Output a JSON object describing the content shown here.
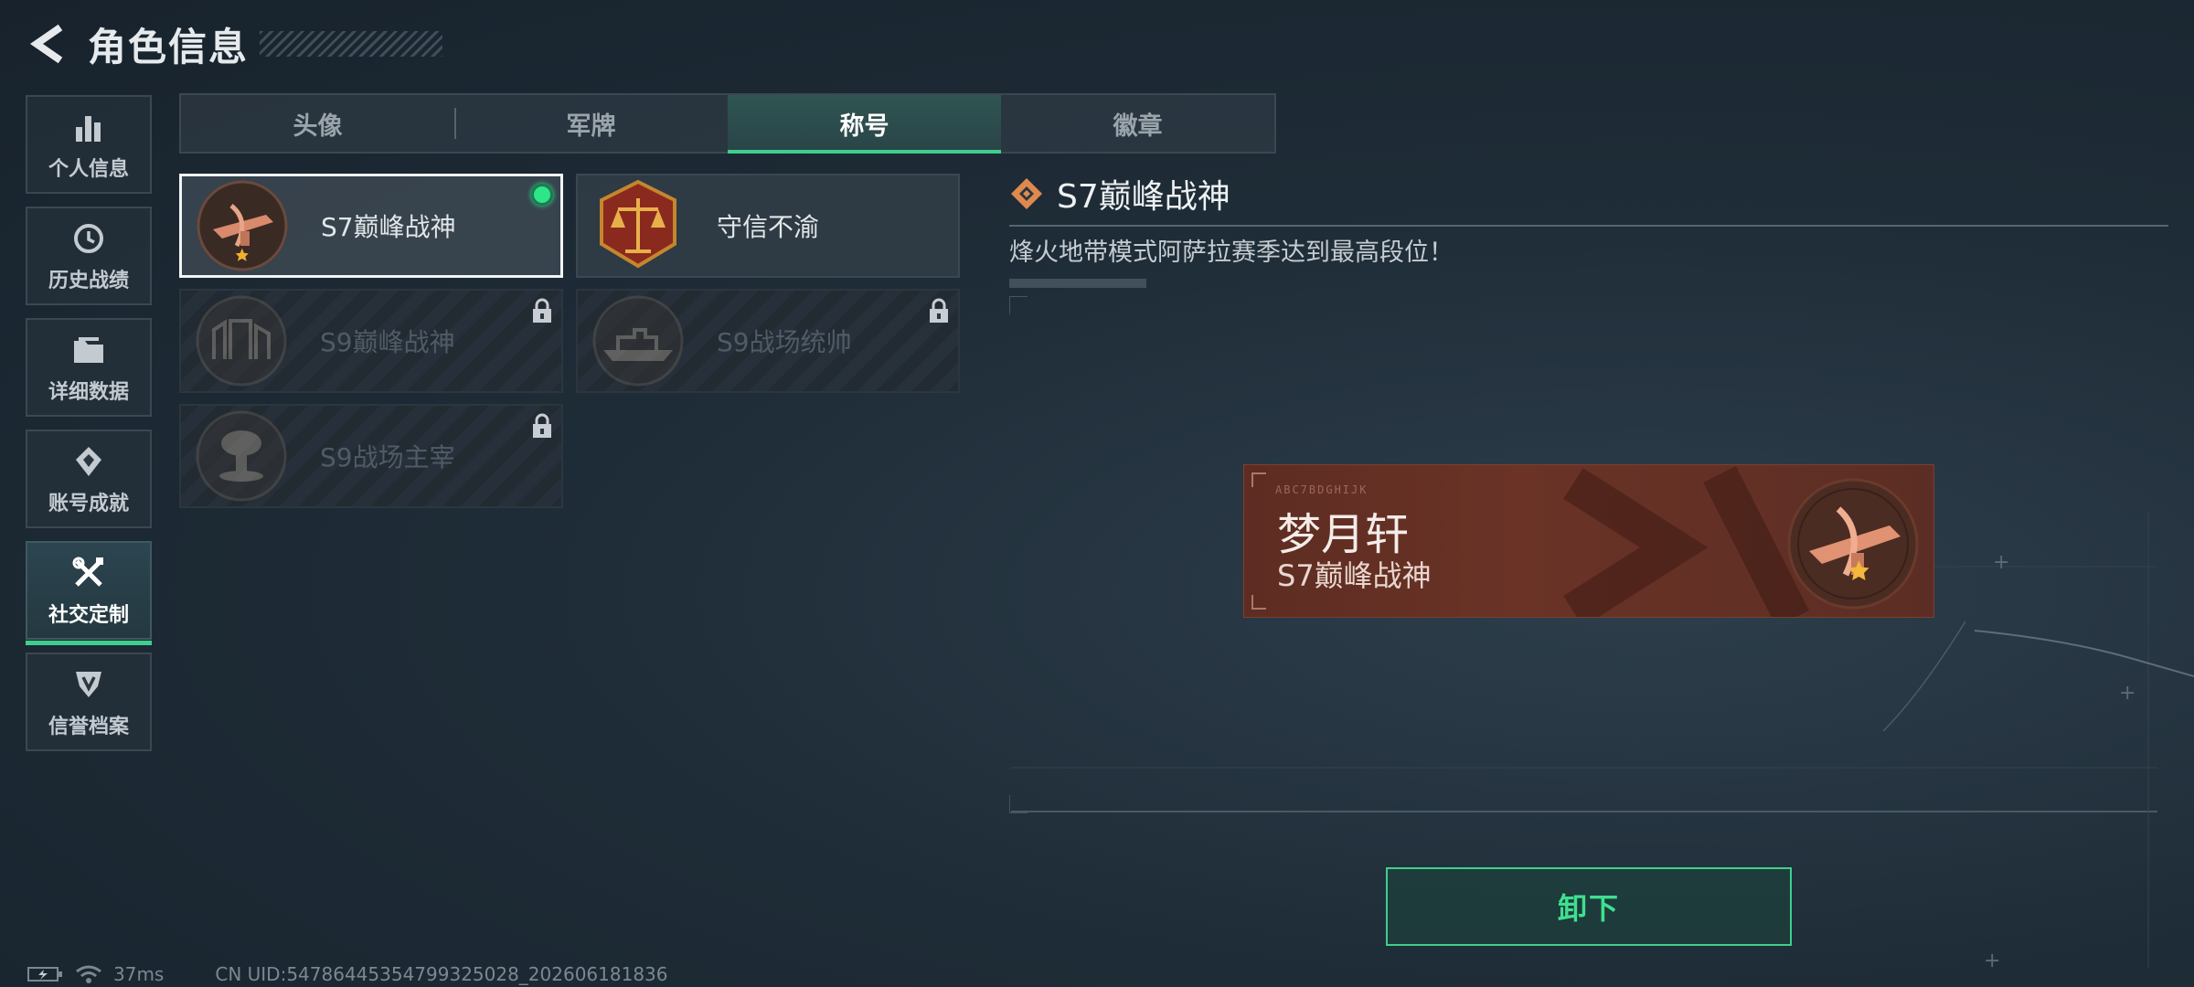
{
  "header": {
    "title": "角色信息"
  },
  "sidenav": {
    "items": [
      {
        "label": "个人信息",
        "icon": "bar-chart-icon",
        "active": false
      },
      {
        "label": "历史战绩",
        "icon": "clock-icon",
        "active": false
      },
      {
        "label": "详细数据",
        "icon": "folder-icon",
        "active": false
      },
      {
        "label": "账号成就",
        "icon": "achievement-icon",
        "active": false
      },
      {
        "label": "社交定制",
        "icon": "tools-icon",
        "active": true
      },
      {
        "label": "信誉档案",
        "icon": "shield-icon",
        "active": false
      }
    ]
  },
  "tabs": [
    {
      "label": "头像",
      "active": false
    },
    {
      "label": "军牌",
      "active": false
    },
    {
      "label": "称号",
      "active": true
    },
    {
      "label": "徽章",
      "active": false
    }
  ],
  "titles": [
    {
      "name": "S7巅峰战神",
      "state": "equipped",
      "emblem": "crossbow-emblem"
    },
    {
      "name": "守信不渝",
      "state": "unlocked",
      "emblem": "scales-emblem"
    },
    {
      "name": "S9巅峰战神",
      "state": "locked",
      "emblem": "fortress-emblem"
    },
    {
      "name": "S9战场统帅",
      "state": "locked",
      "emblem": "warship-emblem"
    },
    {
      "name": "S9战场主宰",
      "state": "locked",
      "emblem": "mushroom-cloud-emblem"
    }
  ],
  "detail": {
    "title": "S7巅峰战神",
    "description": "烽火地带模式阿萨拉赛季达到最高段位！",
    "icon": "diamond-icon"
  },
  "preview": {
    "player_name": "梦月轩",
    "title": "S7巅峰战神",
    "code": "ABC7BDGHIJK"
  },
  "actions": {
    "unequip_label": "卸下"
  },
  "status": {
    "ping": "37ms",
    "uid": "CN UID:54786445354799325028_202606181836"
  },
  "colors": {
    "accent": "#3ecf8e",
    "equipped_dot": "#2ee58a",
    "banner": "#632f24"
  }
}
